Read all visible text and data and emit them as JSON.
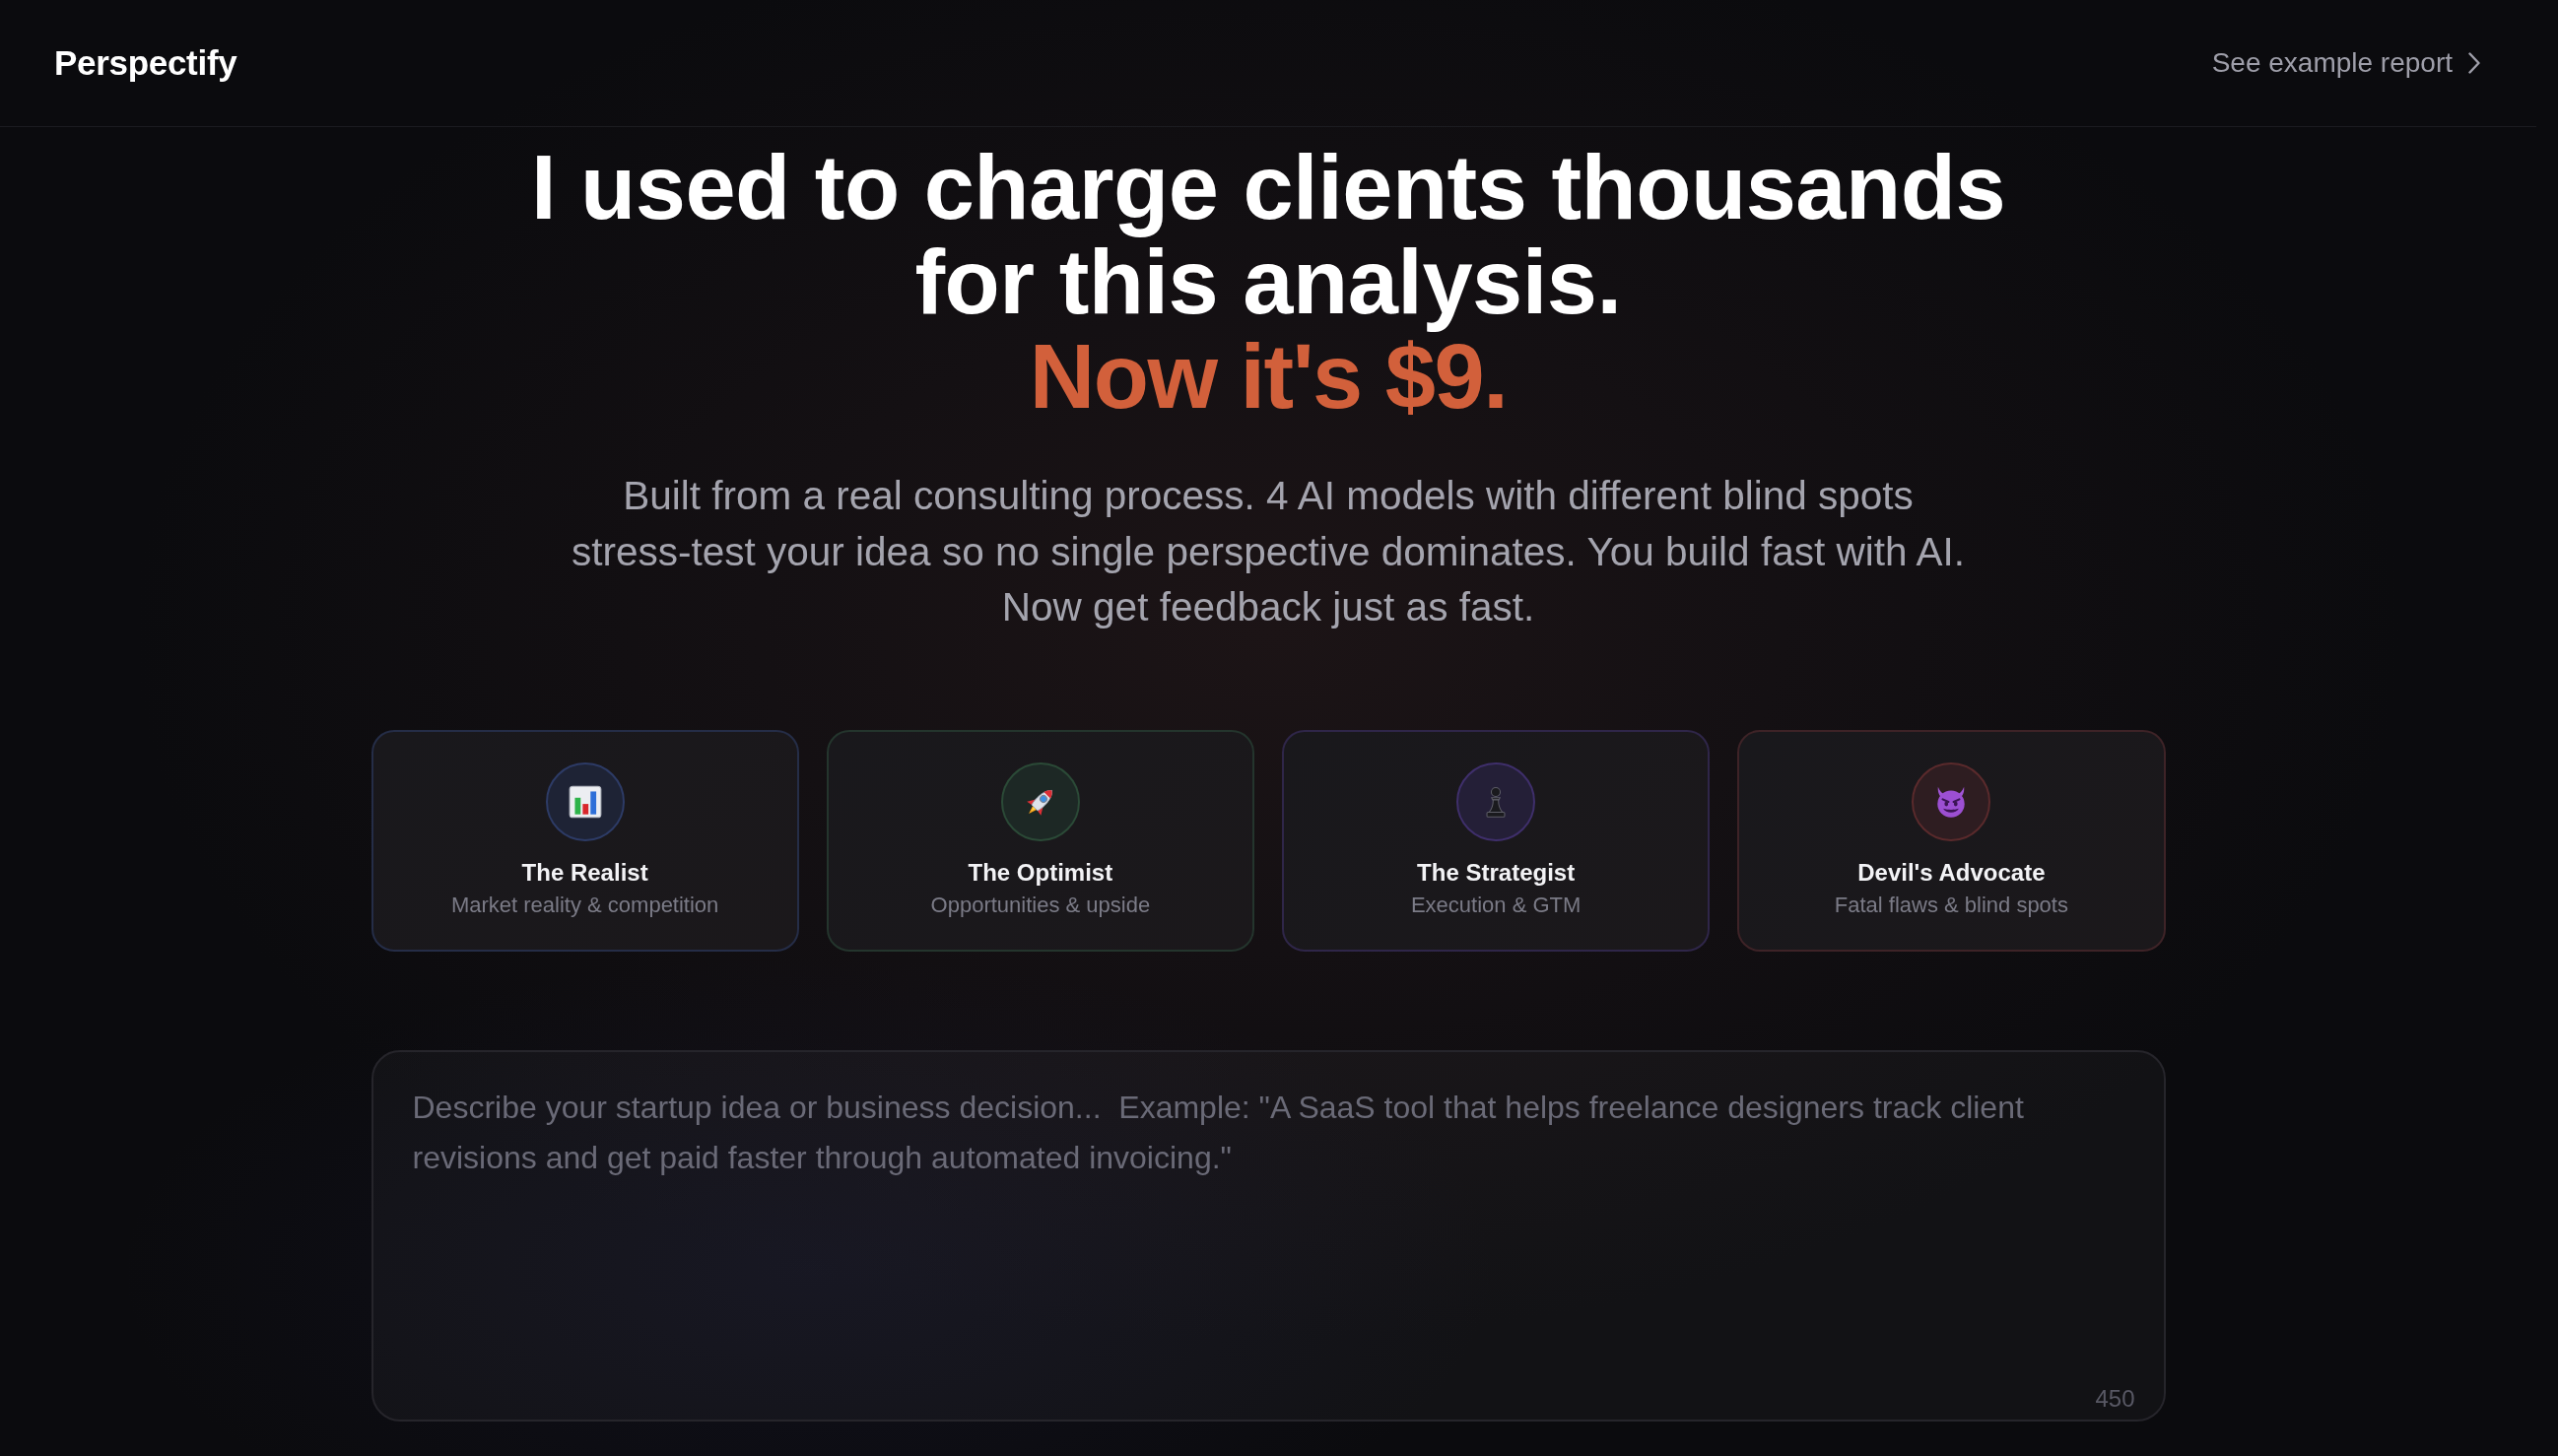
{
  "header": {
    "logo": "Perspectify",
    "link": "See example report"
  },
  "hero": {
    "headline": "I used to charge clients thousands for this analysis.",
    "highlight": "Now it's $9.",
    "subtitle": "Built from a real consulting process. 4 AI models with different blind spots stress-test your idea so no single perspective dominates. You build fast with AI. Now get feedback just as fast."
  },
  "personas": [
    {
      "kind": "chart",
      "name": "The Realist",
      "focus": "Market reality & competition",
      "color": "#2d3b66"
    },
    {
      "kind": "rocket",
      "name": "The Optimist",
      "focus": "Opportunities & upside",
      "color": "#2b4a37"
    },
    {
      "kind": "pawn",
      "name": "The Strategist",
      "focus": "Execution & GTM",
      "color": "#3f2f6b"
    },
    {
      "kind": "devil",
      "name": "Devil's Advocate",
      "focus": "Fatal flaws & blind spots",
      "color": "#5a2a2c"
    }
  ],
  "idea_input": {
    "placeholder": "Describe your startup idea or business decision...  Example: \"A SaaS tool that helps freelance designers track client revisions and get paid faster through automated invoicing.\"",
    "counter": "450"
  }
}
